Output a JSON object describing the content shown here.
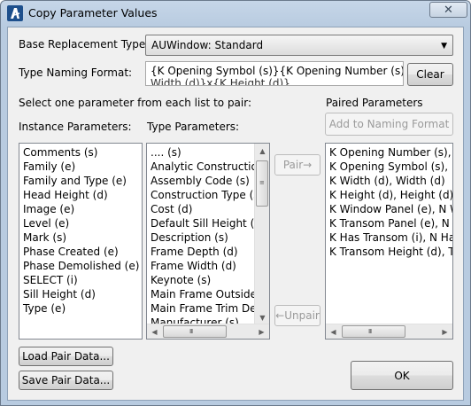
{
  "window": {
    "title": "Copy Parameter Values",
    "close_glyph": "✕"
  },
  "base": {
    "label": "Base Replacement Type:",
    "selected": "AUWindow: Standard"
  },
  "naming": {
    "label": "Type Naming Format:",
    "value": "{K Opening Symbol (s)}{K Opening Number (s)} {K",
    "value_line2": "Width (d)}x{K Height (d)}",
    "clear_label": "Clear"
  },
  "instructions": "Select one parameter from each list to pair:",
  "instance": {
    "header": "Instance Parameters:",
    "items": [
      "Comments (s)",
      "Family (e)",
      "Family and Type (e)",
      "Head Height (d)",
      "Image (e)",
      "Level (e)",
      "Mark (s)",
      "Phase Created (e)",
      "Phase Demolished (e)",
      "SELECT (i)",
      "Sill Height (d)",
      "Type (e)"
    ]
  },
  "type": {
    "header": "Type Parameters:",
    "items": [
      ".... (s)",
      "Analytic Construction",
      "Assembly Code (s)",
      "Construction Type (s)",
      "Cost (d)",
      "Default Sill Height (d)",
      "Description (s)",
      "Frame Depth (d)",
      "Frame Width (d)",
      "Keynote (s)",
      "Main Frame Outside D",
      "Main Frame Trim Dept",
      "Manufacturer (s)"
    ]
  },
  "pair_controls": {
    "pair_label": "Pair→",
    "unpair_label": "←Unpair"
  },
  "paired": {
    "header": "Paired Parameters",
    "add_label": "Add to Naming Format",
    "items": [
      "K Opening Number (s), N Opening Number (s)",
      "K Opening Symbol (s), N Opening Symbol (s)",
      "K Width (d), Width (d)",
      "K Height (d), Height (d)",
      "K Window Panel (e), N Window Panel (e)",
      "K Transom Panel (e), N Transom Panel (e)",
      "K Has Transom (i), N Has Transom (i)",
      "K Transom Height (d), Transom Height (d)"
    ]
  },
  "footer": {
    "load_label": "Load Pair Data...",
    "save_label": "Save Pair Data...",
    "ok_label": "OK"
  },
  "scroll_arrows": {
    "up": "▲",
    "down": "▼",
    "left": "◀",
    "right": "▶",
    "grip_h": "III",
    "grip_v": "≡"
  },
  "colors": {
    "titlebar": "#b8cbe0",
    "dialog_bg": "#f0f0f0",
    "disabled_text": "#9a9a9a"
  }
}
